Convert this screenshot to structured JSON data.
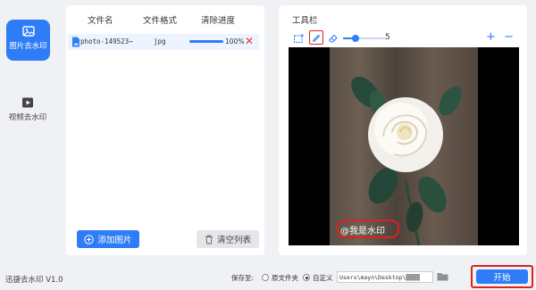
{
  "nav": {
    "items": [
      {
        "label": "图片去水印",
        "icon": "image-icon",
        "active": true
      },
      {
        "label": "视频去水印",
        "icon": "video-icon",
        "active": false
      }
    ]
  },
  "file_list": {
    "columns": [
      "文件名",
      "文件格式",
      "清除进度"
    ],
    "rows": [
      {
        "name": "photo-149523⋯",
        "format": "jpg",
        "progress_label": "100%",
        "progress": 1.0
      }
    ],
    "add_button": "添加图片",
    "clear_button": "清空列表"
  },
  "toolbar": {
    "title": "工具栏",
    "brush_size": "5",
    "brush_level": 0.3,
    "zoom_in": "+",
    "zoom_out": "−"
  },
  "preview": {
    "watermark_text": "@我是水印"
  },
  "footer": {
    "brand": "迅捷去水印 V1.0",
    "save_label": "保存至:",
    "option_original": "原文件夹",
    "option_custom": "自定义",
    "selected_option": "custom",
    "path": "Users\\mayn\\Desktop\\▒▒▒▒",
    "start_button": "开始"
  },
  "colors": {
    "accent": "#2f7df6",
    "highlight": "#e02020",
    "background": "#f0f1f4"
  }
}
